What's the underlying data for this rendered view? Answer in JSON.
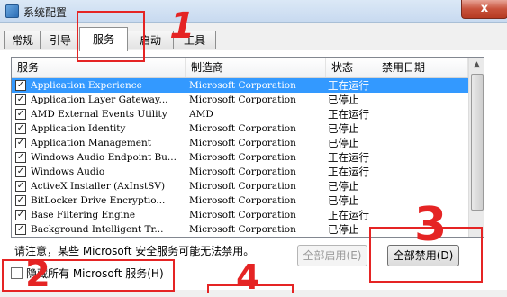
{
  "window": {
    "title": "系统配置",
    "close_label": "x"
  },
  "tabs": [
    {
      "label": "常规"
    },
    {
      "label": "引导"
    },
    {
      "label": "服务"
    },
    {
      "label": "启动"
    },
    {
      "label": "工具"
    }
  ],
  "list": {
    "headers": [
      "服务",
      "制造商",
      "状态",
      "禁用日期"
    ],
    "rows": [
      {
        "name": "Application Experience",
        "vendor": "Microsoft Corporation",
        "status": "正在运行",
        "checked": true,
        "selected": true
      },
      {
        "name": "Application Layer Gateway...",
        "vendor": "Microsoft Corporation",
        "status": "已停止",
        "checked": true
      },
      {
        "name": "AMD External Events Utility",
        "vendor": "AMD",
        "status": "正在运行",
        "checked": true
      },
      {
        "name": "Application Identity",
        "vendor": "Microsoft Corporation",
        "status": "已停止",
        "checked": true
      },
      {
        "name": "Application Management",
        "vendor": "Microsoft Corporation",
        "status": "已停止",
        "checked": true
      },
      {
        "name": "Windows Audio Endpoint Bu...",
        "vendor": "Microsoft Corporation",
        "status": "正在运行",
        "checked": true
      },
      {
        "name": "Windows Audio",
        "vendor": "Microsoft Corporation",
        "status": "正在运行",
        "checked": true
      },
      {
        "name": "ActiveX Installer (AxInstSV)",
        "vendor": "Microsoft Corporation",
        "status": "已停止",
        "checked": true
      },
      {
        "name": "BitLocker Drive Encryptio...",
        "vendor": "Microsoft Corporation",
        "status": "已停止",
        "checked": true
      },
      {
        "name": "Base Filtering Engine",
        "vendor": "Microsoft Corporation",
        "status": "正在运行",
        "checked": true
      },
      {
        "name": "Background Intelligent Tr...",
        "vendor": "Microsoft Corporation",
        "status": "已停止",
        "checked": true
      }
    ]
  },
  "notice": "请注意，某些 Microsoft 安全服务可能无法禁用。",
  "buttons": {
    "enable_all": "全部启用(E)",
    "disable_all": "全部禁用(D)"
  },
  "hide_ms": {
    "label": "隐藏所有 Microsoft 服务(H)",
    "checked": false
  },
  "annotations": [
    "1",
    "2",
    "3",
    "4"
  ],
  "colors": {
    "annotation": "#e52424",
    "selection": "#3399ff"
  }
}
